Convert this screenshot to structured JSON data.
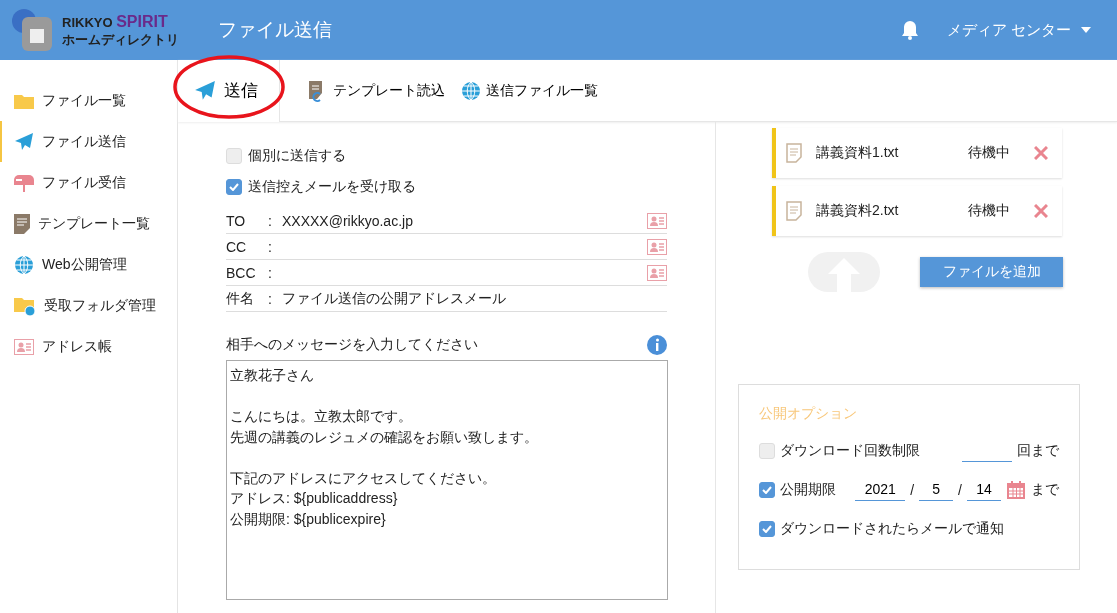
{
  "header": {
    "logo_line1": "RIKKYO ",
    "logo_line1_accent": "SPIRIT",
    "logo_line2": "ホームディレクトリ",
    "title": "ファイル送信",
    "user": "メディア センター"
  },
  "sidebar": {
    "items": [
      {
        "label": "ファイル一覧",
        "kind": "folder",
        "selected": false
      },
      {
        "label": "ファイル送信",
        "kind": "send",
        "selected": true
      },
      {
        "label": "ファイル受信",
        "kind": "mailbox",
        "selected": false
      },
      {
        "label": "テンプレート一覧",
        "kind": "doc",
        "selected": false
      },
      {
        "label": "Web公開管理",
        "kind": "globe",
        "selected": false
      },
      {
        "label": "受取フォルダ管理",
        "kind": "folderglobe",
        "selected": false
      },
      {
        "label": "アドレス帳",
        "kind": "card",
        "selected": false
      }
    ]
  },
  "toolbar": {
    "send": {
      "label": "送信",
      "highlighted": true
    },
    "items": [
      {
        "label": "テンプレート読込",
        "kind": "template"
      },
      {
        "label": "送信ファイル一覧",
        "kind": "globe"
      }
    ]
  },
  "form": {
    "options": [
      {
        "label": "個別に送信する",
        "checked": false
      },
      {
        "label": "送信控えメールを受け取る",
        "checked": true
      }
    ],
    "fields": [
      {
        "label": "TO",
        "separator": ":",
        "value": "XXXXX@rikkyo.ac.jp",
        "address_book": true
      },
      {
        "label": "CC",
        "separator": ":",
        "address_book": true
      },
      {
        "label": "BCC",
        "separator": ":",
        "address_book": true
      },
      {
        "label": "件名",
        "separator": ":",
        "value": "ファイル送信の公開アドレスメール",
        "address_book": false
      }
    ],
    "message_label": "相手へのメッセージを入力してください",
    "message_paragraphs": [
      [
        "立教花子さん"
      ],
      [
        "こんにちは。立教太郎です。",
        "先週の講義のレジュメの確認をお願い致します。"
      ],
      [
        "下記のアドレスにアクセスしてください。",
        "アドレス: ${publicaddress}",
        "公開期限: ${publicexpire}"
      ]
    ]
  },
  "files": [
    {
      "name": "講義資料1.txt",
      "status": "待機中"
    },
    {
      "name": "講義資料2.txt",
      "status": "待機中"
    }
  ],
  "add_file_button": "ファイルを追加",
  "publish_options": {
    "title": "公開オプション",
    "download_limit": {
      "label": "ダウンロード回数制限",
      "checked": false,
      "suffix": "回まで"
    },
    "expiry": {
      "label": "公開期限",
      "checked": true,
      "year": "2021",
      "month": "5",
      "day": "14",
      "separator1": "/",
      "separator2": "/",
      "suffix": "まで"
    },
    "notify": {
      "label": "ダウンロードされたらメールで通知",
      "checked": true
    }
  }
}
